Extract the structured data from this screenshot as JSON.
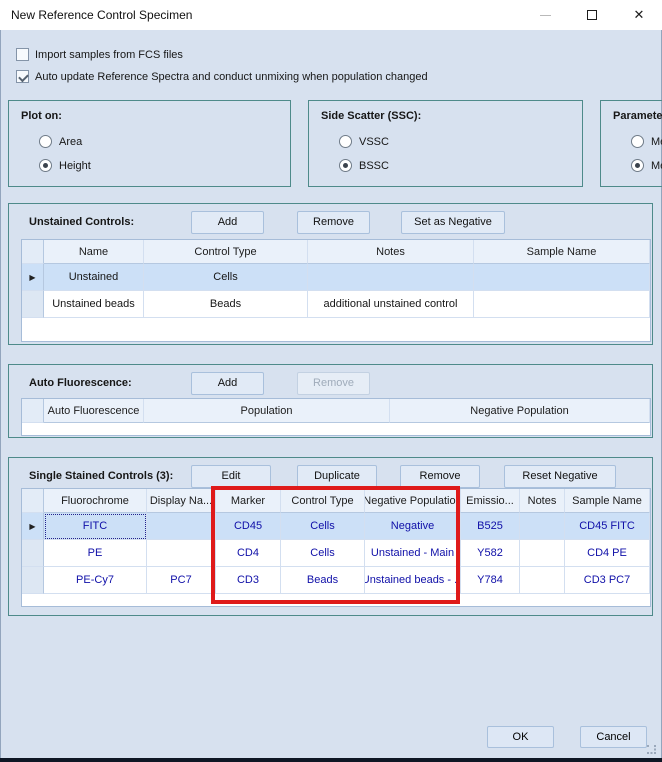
{
  "window": {
    "title": "New Reference Control Specimen"
  },
  "checkboxes": {
    "import_fcs": {
      "label": "Import samples from FCS files",
      "checked": false
    },
    "auto_update": {
      "label": "Auto update Reference Spectra and conduct unmixing when population changed",
      "checked": true
    }
  },
  "groups": {
    "plot_on": {
      "label": "Plot on:",
      "options": [
        {
          "label": "Area",
          "selected": false
        },
        {
          "label": "Height",
          "selected": true
        }
      ]
    },
    "side_scatter": {
      "label": "Side Scatter (SSC):",
      "options": [
        {
          "label": "VSSC",
          "selected": false
        },
        {
          "label": "BSSC",
          "selected": true
        }
      ]
    },
    "parameter": {
      "label": "Parameter",
      "options": [
        {
          "label": "Me",
          "selected": false
        },
        {
          "label": "Me",
          "selected": true
        }
      ]
    }
  },
  "unstained": {
    "label": "Unstained Controls:",
    "buttons": {
      "add": "Add",
      "remove": "Remove",
      "set_negative": "Set as Negative"
    },
    "table": {
      "columns": [
        "Name",
        "Control Type",
        "Notes",
        "Sample Name"
      ],
      "rows": [
        {
          "cells": [
            "Unstained",
            "Cells",
            "",
            ""
          ],
          "selected": true,
          "arrow": true
        },
        {
          "cells": [
            "Unstained beads",
            "Beads",
            "additional unstained control",
            ""
          ],
          "selected": false,
          "arrow": false
        }
      ]
    }
  },
  "auto_fluorescence": {
    "label": "Auto Fluorescence:",
    "buttons": {
      "add": "Add",
      "remove": "Remove"
    },
    "remove_disabled": true,
    "table": {
      "columns": [
        "Auto Fluorescence",
        "Population",
        "Negative Population"
      ],
      "rows": []
    }
  },
  "single_stained": {
    "label": "Single Stained Controls (3):",
    "buttons": {
      "edit": "Edit",
      "duplicate": "Duplicate",
      "remove": "Remove",
      "reset_negative": "Reset Negative"
    },
    "table": {
      "columns": [
        "Fluorochrome",
        "Display Na...",
        "Marker",
        "Control Type",
        "Negative Population",
        "Emissio...",
        "Notes",
        "Sample Name"
      ],
      "rows": [
        {
          "cells": [
            "FITC",
            "",
            "CD45",
            "Cells",
            "Negative",
            "B525",
            "",
            "CD45 FITC"
          ],
          "selected": true,
          "arrow": true,
          "focus_cell": 0
        },
        {
          "cells": [
            "PE",
            "",
            "CD4",
            "Cells",
            "Unstained - Main",
            "Y582",
            "",
            "CD4 PE"
          ],
          "selected": false,
          "arrow": false
        },
        {
          "cells": [
            "PE-Cy7",
            "PC7",
            "CD3",
            "Beads",
            "Unstained beads - ...",
            "Y784",
            "",
            "CD3 PC7"
          ],
          "selected": false,
          "arrow": false
        }
      ]
    },
    "highlighted_columns": [
      "Marker",
      "Control Type",
      "Negative Population"
    ]
  },
  "footer": {
    "ok": "OK",
    "cancel": "Cancel"
  },
  "colors": {
    "dialog_background": "#d7e1ef",
    "group_border_teal": "#4e8a8a",
    "selection_blue": "#cce0f7",
    "grid_text_navy": "#0f0fa8",
    "highlight_red": "#df1a1a"
  }
}
